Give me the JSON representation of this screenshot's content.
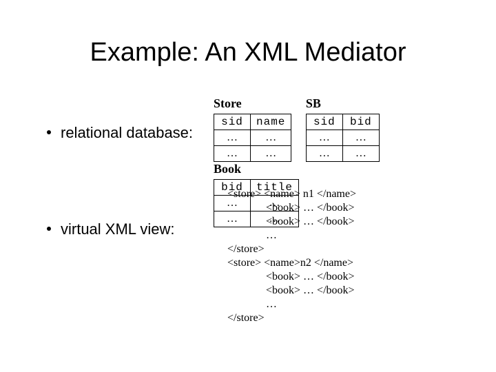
{
  "title": "Example: An XML Mediator",
  "bullet1": "relational database:",
  "bullet2": "virtual XML view:",
  "tables": {
    "store": {
      "caption": "Store",
      "headers": [
        "sid",
        "name"
      ],
      "rows": [
        [
          "…",
          "…"
        ],
        [
          "…",
          "…"
        ]
      ]
    },
    "sb": {
      "caption": "SB",
      "headers": [
        "sid",
        "bid"
      ],
      "rows": [
        [
          "…",
          "…"
        ],
        [
          "…",
          "…"
        ]
      ]
    },
    "book": {
      "caption": "Book",
      "headers": [
        "bid",
        "title"
      ],
      "rows": [
        [
          "…",
          "…"
        ],
        [
          "…",
          "…"
        ]
      ]
    }
  },
  "xml": {
    "l1": "<store> <name> n1 </name>",
    "l2": "              <book> … </book>",
    "l3": "              <book> … </book>",
    "l4": "              …",
    "l5": "</store>",
    "l6": "<store> <name>n2 </name>",
    "l7": "              <book> … </book>",
    "l8": "              <book> … </book>",
    "l9": "              … ",
    "l10": "</store>"
  }
}
